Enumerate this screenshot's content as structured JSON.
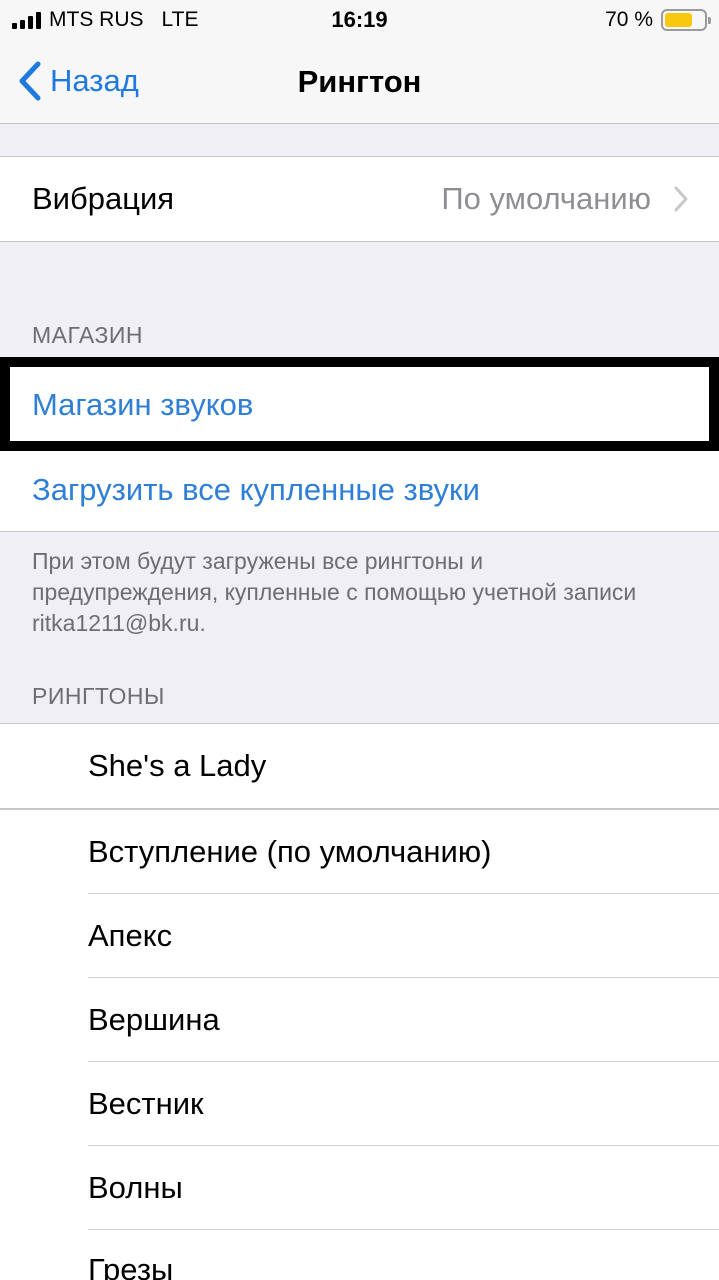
{
  "status_bar": {
    "carrier": "MTS RUS",
    "network": "LTE",
    "time": "16:19",
    "battery": "70 %",
    "battery_level": 0.7,
    "battery_color": "#f6c90e"
  },
  "nav": {
    "back_label": "Назад",
    "title": "Рингтон"
  },
  "vibration": {
    "label": "Вибрация",
    "value": "По умолчанию"
  },
  "store": {
    "header": "МАГАЗИН",
    "tone_store": "Магазин звуков",
    "download_all": "Загрузить все купленные звуки",
    "footer": "При этом будут загружены все рингтоны и предупреждения, купленные с помощью учетной записи ritka1211@bk.ru."
  },
  "ringtones": {
    "header": "РИНГТОНЫ",
    "custom": "She's a Lady",
    "items": [
      "Вступление (по умолчанию)",
      "Апекс",
      "Вершина",
      "Вестник",
      "Волны",
      "Грезы"
    ]
  },
  "colors": {
    "accent": "#1f7ae0",
    "background": "#efeff4"
  }
}
